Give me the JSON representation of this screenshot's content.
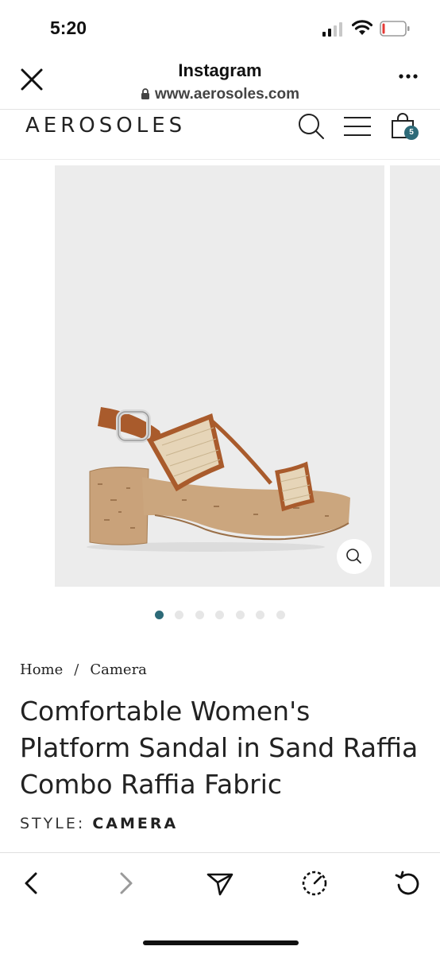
{
  "status_bar": {
    "time": "5:20"
  },
  "browser": {
    "title": "Instagram",
    "url": "www.aerosoles.com"
  },
  "site": {
    "logo": "AEROSOLES",
    "cart_count": "5"
  },
  "carousel": {
    "total_slides": 7,
    "active_index": 0
  },
  "breadcrumb": {
    "home": "Home",
    "separator": "/",
    "current": "Camera"
  },
  "product": {
    "title": "Comfortable Women's Platform Sandal in Sand Raffia Combo Raffia Fabric",
    "style_label": "STYLE:",
    "style_value": "CAMERA"
  },
  "colors": {
    "accent": "#2d6a78",
    "image_bg": "#ececec"
  }
}
